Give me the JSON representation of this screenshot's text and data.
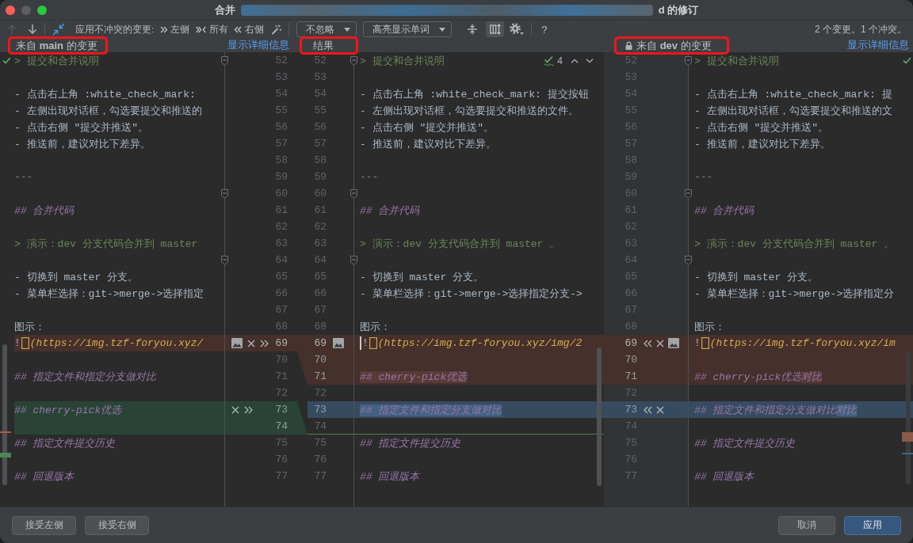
{
  "window": {
    "title_start": "合并",
    "title_end": "d 的修订"
  },
  "toolbar": {
    "navigation": [
      {
        "kind": "up",
        "disabled": true
      },
      {
        "kind": "down",
        "disabled": false
      }
    ],
    "apply_label": "应用不冲突的变更:",
    "apply_actions": [
      {
        "kind": "left",
        "label": "左侧"
      },
      {
        "kind": "all",
        "label": "所有"
      },
      {
        "kind": "right",
        "label": "右侧"
      }
    ],
    "dropdowns": [
      {
        "value": "不忽略"
      },
      {
        "value": "高亮显示单词"
      }
    ],
    "view_toggles": [
      {
        "kind": "collapse",
        "selected": false
      },
      {
        "kind": "sync-scroll",
        "selected": true
      }
    ],
    "help": "?",
    "status": "2 个变更。1 个冲突。"
  },
  "panes": [
    {
      "kind": "left",
      "title": "来自 **main** 的变更",
      "locked": false,
      "highlighted": true,
      "details_link": "显示详细信息",
      "blocks": [
        {
          "kind": "unchanged",
          "lines": [
            {
              "number": "52",
              "kind": "quote",
              "text": "> 提交和合并说明",
              "fold": true,
              "current": false
            },
            {
              "number": "53",
              "fold": false,
              "current": false
            },
            {
              "number": "54",
              "kind": "plain",
              "text": "- 点击右上角 :white_check_mark:",
              "fold": false,
              "current": false
            },
            {
              "number": "55",
              "kind": "plain",
              "text": "- 左侧出现对话框，勾选要提交和推送的",
              "fold": false,
              "current": false
            },
            {
              "number": "56",
              "kind": "plain",
              "text": "- 点击右侧 \"提交并推送\"。",
              "fold": false,
              "current": false
            },
            {
              "number": "57",
              "kind": "plain",
              "text": "- 推送前，建议对比下差异。",
              "fold": false,
              "current": false
            },
            {
              "number": "58",
              "fold": false,
              "current": false
            },
            {
              "number": "59",
              "kind": "rule",
              "text": "---",
              "fold": false,
              "current": false
            },
            {
              "number": "60",
              "fold": true,
              "current": false
            },
            {
              "number": "61",
              "kind": "heading",
              "text": "## 合并代码",
              "fold": false,
              "current": false
            },
            {
              "number": "62",
              "fold": false,
              "current": false
            },
            {
              "number": "63",
              "kind": "quote",
              "text": "> 演示：dev 分支代码合并到 master",
              "fold": false,
              "current": false
            },
            {
              "number": "64",
              "fold": true,
              "current": false
            },
            {
              "number": "65",
              "kind": "plain",
              "text": "- 切换到 master 分支。",
              "fold": false,
              "current": false
            },
            {
              "number": "66",
              "kind": "plain",
              "text": "- 菜单栏选择：git->merge->选择指定",
              "fold": false,
              "current": false
            },
            {
              "number": "67",
              "fold": false,
              "current": false
            },
            {
              "number": "68",
              "kind": "plain",
              "text": "图示：",
              "fold": false,
              "current": false
            }
          ]
        },
        {
          "kind": "conflict",
          "lines": [
            {
              "number": "69",
              "kind": "image-link",
              "prefix": "!",
              "url": "(https://img.tzf-foryou.xyz/",
              "fold": false,
              "current": true,
              "gutter_icons": [
                {
                  "kind": "image"
                },
                {
                  "kind": "reject"
                },
                {
                  "kind": "accept-right"
                }
              ]
            }
          ]
        },
        {
          "kind": "unchanged",
          "lines": [
            {
              "number": "70",
              "fold": false,
              "current": false
            },
            {
              "number": "71",
              "kind": "heading",
              "text": "## 指定文件和指定分支做对比",
              "fold": false,
              "current": false
            },
            {
              "number": "72",
              "fold": false,
              "current": false
            }
          ]
        },
        {
          "kind": "inserted",
          "lines": [
            {
              "number": "73",
              "kind": "heading",
              "text": "## cherry-pick优选",
              "fold": false,
              "current": false,
              "gutter_icons": [
                {
                  "kind": "reject"
                },
                {
                  "kind": "accept-right"
                }
              ]
            },
            {
              "number": "74",
              "fold": false,
              "current": false
            }
          ]
        },
        {
          "kind": "unchanged",
          "lines": [
            {
              "number": "75",
              "kind": "heading",
              "text": "## 指定文件提交历史",
              "fold": false,
              "current": false
            },
            {
              "number": "76",
              "fold": false,
              "current": false
            },
            {
              "number": "77",
              "kind": "heading",
              "text": "## 回退版本",
              "fold": false,
              "current": false
            }
          ]
        }
      ]
    },
    {
      "kind": "result",
      "title": "结果",
      "locked": false,
      "highlighted": true,
      "inspection": {
        "count": "4"
      },
      "blocks": [
        {
          "kind": "unchanged",
          "lines": [
            {
              "number": "52",
              "kind": "quote",
              "text": "> 提交和合并说明",
              "fold": true,
              "current": false
            },
            {
              "number": "53",
              "fold": false,
              "current": false
            },
            {
              "number": "54",
              "kind": "plain",
              "text": "- 点击右上角 :white_check_mark: 提交按钮",
              "fold": false,
              "current": false
            },
            {
              "number": "55",
              "kind": "plain",
              "text": "- 左侧出现对话框，勾选要提交和推送的文件。",
              "fold": false,
              "current": false
            },
            {
              "number": "56",
              "kind": "plain",
              "text": "- 点击右侧 \"提交并推送\"。",
              "fold": false,
              "current": false
            },
            {
              "number": "57",
              "kind": "plain",
              "text": "- 推送前，建议对比下差异。",
              "fold": false,
              "current": false
            },
            {
              "number": "58",
              "fold": false,
              "current": false
            },
            {
              "number": "59",
              "kind": "rule",
              "text": "---",
              "fold": false,
              "current": false
            },
            {
              "number": "60",
              "fold": true,
              "current": false
            },
            {
              "number": "61",
              "kind": "heading",
              "text": "## 合并代码",
              "fold": false,
              "current": false
            },
            {
              "number": "62",
              "fold": false,
              "current": false
            },
            {
              "number": "63",
              "kind": "quote",
              "text": "> 演示：dev 分支代码合并到 master 。",
              "fold": false,
              "current": false
            },
            {
              "number": "64",
              "fold": true,
              "current": false
            },
            {
              "number": "65",
              "kind": "plain",
              "text": "- 切换到 master 分支。",
              "fold": false,
              "current": false
            },
            {
              "number": "66",
              "kind": "plain",
              "text": "- 菜单栏选择：git->merge->选择指定分支->",
              "fold": false,
              "current": false
            },
            {
              "number": "67",
              "fold": false,
              "current": false
            },
            {
              "number": "68",
              "kind": "plain",
              "text": "图示：",
              "fold": false,
              "current": false
            }
          ]
        },
        {
          "kind": "conflict",
          "lines": [
            {
              "number": "69",
              "kind": "image-link",
              "prefix": "!",
              "url": "(https://img.tzf-foryou.xyz/img/2",
              "fold": false,
              "current": true,
              "gutter_icons": [
                {
                  "kind": "image"
                }
              ]
            },
            {
              "number": "70",
              "fold": false,
              "current": false
            },
            {
              "number": "71",
              "kind": "heading",
              "highlighted_text": "## cherry-pick优选",
              "fold": false,
              "current": false
            }
          ]
        },
        {
          "kind": "unchanged",
          "lines": [
            {
              "number": "72",
              "fold": false,
              "current": false
            }
          ]
        },
        {
          "kind": "modified",
          "lines": [
            {
              "number": "73",
              "kind": "heading",
              "highlighted_text": "## 指定文件和指定分支做对比",
              "fold": false,
              "current": false
            }
          ]
        },
        {
          "kind": "insertion-point",
          "lines": [
            {
              "number": "74",
              "fold": false,
              "current": false
            }
          ]
        },
        {
          "kind": "unchanged",
          "lines": [
            {
              "number": "75",
              "kind": "heading",
              "text": "## 指定文件提交历史",
              "fold": false,
              "current": false
            },
            {
              "number": "76",
              "fold": false,
              "current": false
            },
            {
              "number": "77",
              "kind": "heading",
              "text": "## 回退版本",
              "fold": false,
              "current": false
            }
          ]
        }
      ]
    },
    {
      "kind": "right",
      "title": "来自 **dev** 的变更",
      "locked": true,
      "highlighted": true,
      "details_link": "显示详细信息",
      "blocks": [
        {
          "kind": "unchanged",
          "lines": [
            {
              "number": "52",
              "kind": "quote",
              "text": "> 提交和合并说明",
              "fold": true,
              "current": false
            },
            {
              "number": "53",
              "fold": false,
              "current": false
            },
            {
              "number": "54",
              "kind": "plain",
              "text": "- 点击右上角 :white_check_mark: 提",
              "fold": false,
              "current": false
            },
            {
              "number": "55",
              "kind": "plain",
              "text": "- 左侧出现对话框，勾选要提交和推送的文",
              "fold": false,
              "current": false
            },
            {
              "number": "56",
              "kind": "plain",
              "text": "- 点击右侧 \"提交并推送\"。",
              "fold": false,
              "current": false
            },
            {
              "number": "57",
              "kind": "plain",
              "text": "- 推送前，建议对比下差异。",
              "fold": false,
              "current": false
            },
            {
              "number": "58",
              "fold": false,
              "current": false
            },
            {
              "number": "59",
              "kind": "rule",
              "text": "---",
              "fold": false,
              "current": false
            },
            {
              "number": "60",
              "fold": true,
              "current": false
            },
            {
              "number": "61",
              "kind": "heading",
              "text": "## 合并代码",
              "fold": false,
              "current": false
            },
            {
              "number": "62",
              "fold": false,
              "current": false
            },
            {
              "number": "63",
              "kind": "quote",
              "text": "> 演示：dev 分支代码合并到 master 。",
              "fold": false,
              "current": false
            },
            {
              "number": "64",
              "fold": true,
              "current": false
            },
            {
              "number": "65",
              "kind": "plain",
              "text": "- 切换到 master 分支。",
              "fold": false,
              "current": false
            },
            {
              "number": "66",
              "kind": "plain",
              "text": "- 菜单栏选择：git->merge->选择指定分",
              "fold": false,
              "current": false
            },
            {
              "number": "67",
              "fold": false,
              "current": false
            },
            {
              "number": "68",
              "kind": "plain",
              "text": "图示：",
              "fold": false,
              "current": false
            }
          ]
        },
        {
          "kind": "conflict",
          "lines": [
            {
              "number": "69",
              "kind": "image-link",
              "prefix": "!",
              "url": "(https://img.tzf-foryou.xyz/im",
              "fold": false,
              "current": true,
              "gutter_icons": [
                {
                  "kind": "accept-left"
                },
                {
                  "kind": "reject"
                },
                {
                  "kind": "image"
                }
              ]
            },
            {
              "number": "70",
              "fold": false,
              "current": false
            },
            {
              "number": "71",
              "kind": "heading",
              "text": "## cherry-pick优选",
              "highlighted_text": "对比",
              "fold": false,
              "current": false
            }
          ]
        },
        {
          "kind": "unchanged",
          "lines": [
            {
              "number": "72",
              "fold": false,
              "current": false
            }
          ]
        },
        {
          "kind": "modified",
          "lines": [
            {
              "number": "73",
              "kind": "heading",
              "text": "## 指定文件和指定分支做对比",
              "highlighted_text": "对比",
              "fold": false,
              "current": false,
              "gutter_icons": [
                {
                  "kind": "accept-left"
                },
                {
                  "kind": "reject"
                }
              ]
            }
          ]
        },
        {
          "kind": "unchanged",
          "lines": [
            {
              "number": "74",
              "fold": false,
              "current": false
            },
            {
              "number": "75",
              "kind": "heading",
              "text": "## 指定文件提交历史",
              "fold": false,
              "current": false
            },
            {
              "number": "76",
              "fold": false,
              "current": false
            },
            {
              "number": "77",
              "kind": "heading",
              "text": "## 回退版本",
              "fold": false,
              "current": false
            }
          ]
        }
      ]
    }
  ],
  "footer": {
    "left_buttons": [
      {
        "label": "接受左侧",
        "primary": false
      },
      {
        "label": "接受右侧",
        "primary": false
      }
    ],
    "right_buttons": [
      {
        "label": "取消",
        "primary": false
      },
      {
        "label": "应用",
        "primary": true
      }
    ]
  }
}
